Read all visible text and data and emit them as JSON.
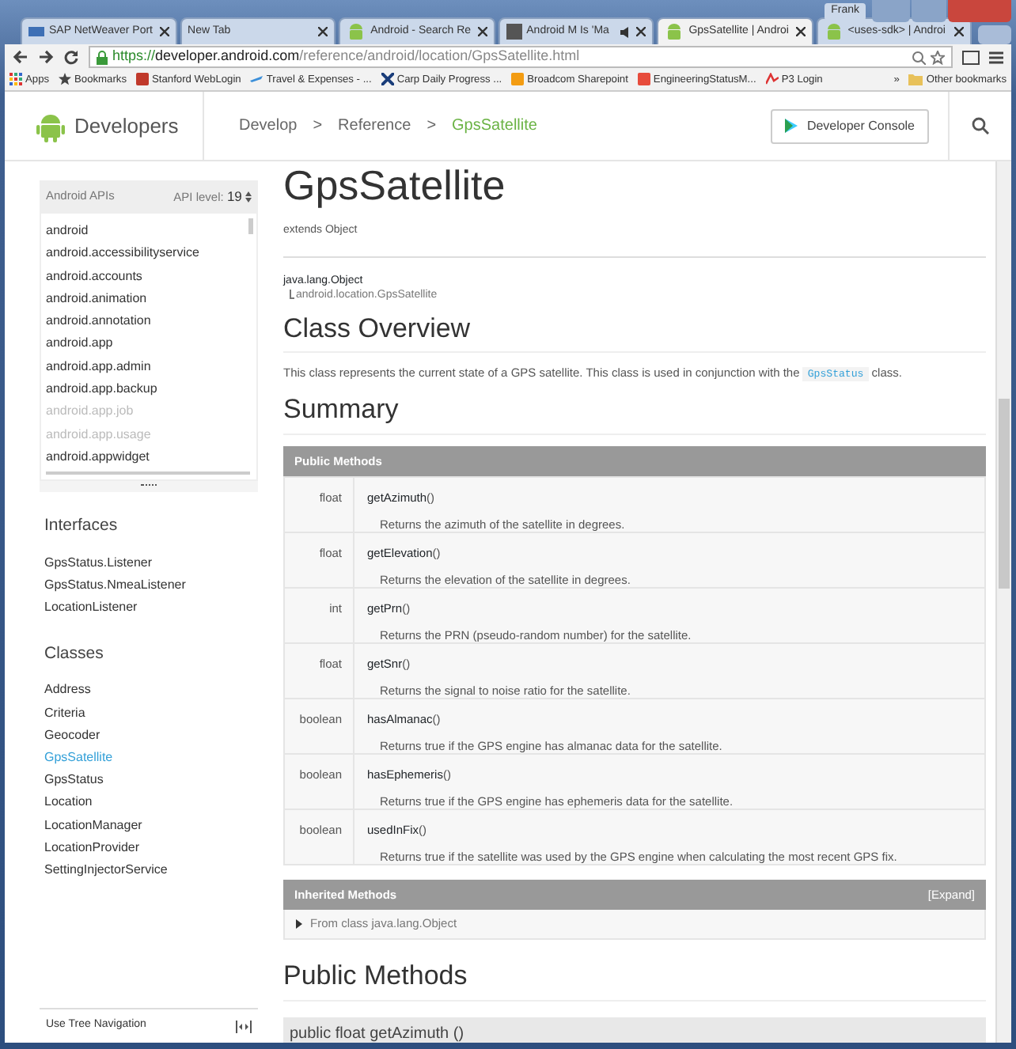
{
  "browser": {
    "tabs": [
      {
        "title": "SAP NetWeaver Port",
        "kind": "sap",
        "audio": false,
        "selected": false
      },
      {
        "title": "New Tab",
        "kind": "blank",
        "audio": false,
        "selected": false
      },
      {
        "title": "Android - Search Re",
        "kind": "android",
        "audio": false,
        "selected": false
      },
      {
        "title": "Android M Is 'Ma",
        "kind": "site",
        "audio": true,
        "selected": false
      },
      {
        "title": "GpsSatellite | Androi",
        "kind": "android",
        "audio": false,
        "selected": true
      },
      {
        "title": "<uses-sdk> | Androi",
        "kind": "android",
        "audio": false,
        "selected": false
      }
    ],
    "user": "Frank",
    "address": {
      "scheme": "https://",
      "host": "developer.android.com",
      "path": "/reference/android/location/GpsSatellite.html"
    },
    "bookmarks": [
      {
        "label": "Apps",
        "kind": "apps"
      },
      {
        "label": "Bookmarks",
        "kind": "star"
      },
      {
        "label": "Stanford WebLogin",
        "kind": "s"
      },
      {
        "label": "Travel & Expenses - ...",
        "kind": "plane"
      },
      {
        "label": "Carp Daily Progress ...",
        "kind": "x"
      },
      {
        "label": "Broadcom Sharepoint",
        "kind": "orange"
      },
      {
        "label": "EngineeringStatusM...",
        "kind": "red"
      },
      {
        "label": "P3 Login",
        "kind": "p3"
      }
    ],
    "overflow": "»",
    "other_bookmarks": "Other bookmarks"
  },
  "header": {
    "logo": "Developers",
    "separator": ">",
    "breadcrumbs": [
      {
        "label": "Develop",
        "current": false
      },
      {
        "label": "Reference",
        "current": false
      },
      {
        "label": "GpsSatellite",
        "current": true
      }
    ],
    "console_button": "Developer Console"
  },
  "sidebar": {
    "api_label": "Android APIs",
    "level_label": "API level:",
    "level_value": "19",
    "packages": [
      {
        "label": "android",
        "disabled": false
      },
      {
        "label": "android.accessibilityservice",
        "disabled": false
      },
      {
        "label": "android.accounts",
        "disabled": false
      },
      {
        "label": "android.animation",
        "disabled": false
      },
      {
        "label": "android.annotation",
        "disabled": false
      },
      {
        "label": "android.app",
        "disabled": false
      },
      {
        "label": "android.app.admin",
        "disabled": false
      },
      {
        "label": "android.app.backup",
        "disabled": false
      },
      {
        "label": "android.app.job",
        "disabled": true
      },
      {
        "label": "android.app.usage",
        "disabled": true
      },
      {
        "label": "android.appwidget",
        "disabled": false
      }
    ],
    "interfaces_title": "Interfaces",
    "interfaces": [
      "GpsStatus.Listener",
      "GpsStatus.NmeaListener",
      "LocationListener"
    ],
    "classes_title": "Classes",
    "classes": [
      {
        "label": "Address",
        "selected": false
      },
      {
        "label": "Criteria",
        "selected": false
      },
      {
        "label": "Geocoder",
        "selected": false
      },
      {
        "label": "GpsSatellite",
        "selected": true
      },
      {
        "label": "GpsStatus",
        "selected": false
      },
      {
        "label": "Location",
        "selected": false
      },
      {
        "label": "LocationManager",
        "selected": false
      },
      {
        "label": "LocationProvider",
        "selected": false
      },
      {
        "label": "SettingInjectorService",
        "selected": false
      }
    ],
    "tree_nav": "Use Tree Navigation"
  },
  "main": {
    "title": "GpsSatellite",
    "extends_label": "extends",
    "extends_link": "Object",
    "hierarchy": [
      "java.lang.Object",
      "android.location.GpsSatellite"
    ],
    "overview_title": "Class Overview",
    "overview": {
      "before": "This class represents the current state of a GPS satellite. This class is used in conjunction with the",
      "code": "GpsStatus",
      "after": "class."
    },
    "summary_title": "Summary",
    "methods_header": "Public Methods",
    "methods": [
      {
        "type": "float",
        "name": "getAzimuth",
        "params": "()",
        "description": "Returns the azimuth of the satellite in degrees."
      },
      {
        "type": "float",
        "name": "getElevation",
        "params": "()",
        "description": "Returns the elevation of the satellite in degrees."
      },
      {
        "type": "int",
        "name": "getPrn",
        "params": "()",
        "description": "Returns the PRN (pseudo-random number) for the satellite."
      },
      {
        "type": "float",
        "name": "getSnr",
        "params": "()",
        "description": "Returns the signal to noise ratio for the satellite."
      },
      {
        "type": "boolean",
        "name": "hasAlmanac",
        "params": "()",
        "description": "Returns true if the GPS engine has almanac data for the satellite."
      },
      {
        "type": "boolean",
        "name": "hasEphemeris",
        "params": "()",
        "description": "Returns true if the GPS engine has ephemeris data for the satellite."
      },
      {
        "type": "boolean",
        "name": "usedInFix",
        "params": "()",
        "description": "Returns true if the satellite was used by the GPS engine when calculating the most recent GPS fix."
      }
    ],
    "inherited_header": "Inherited Methods",
    "expand": "[Expand]",
    "inherited": {
      "label": "From class",
      "link": "java.lang.Object",
      "expanded": false
    },
    "public_methods_title": "Public Methods",
    "detail_signature": "public float getAzimuth ()"
  }
}
